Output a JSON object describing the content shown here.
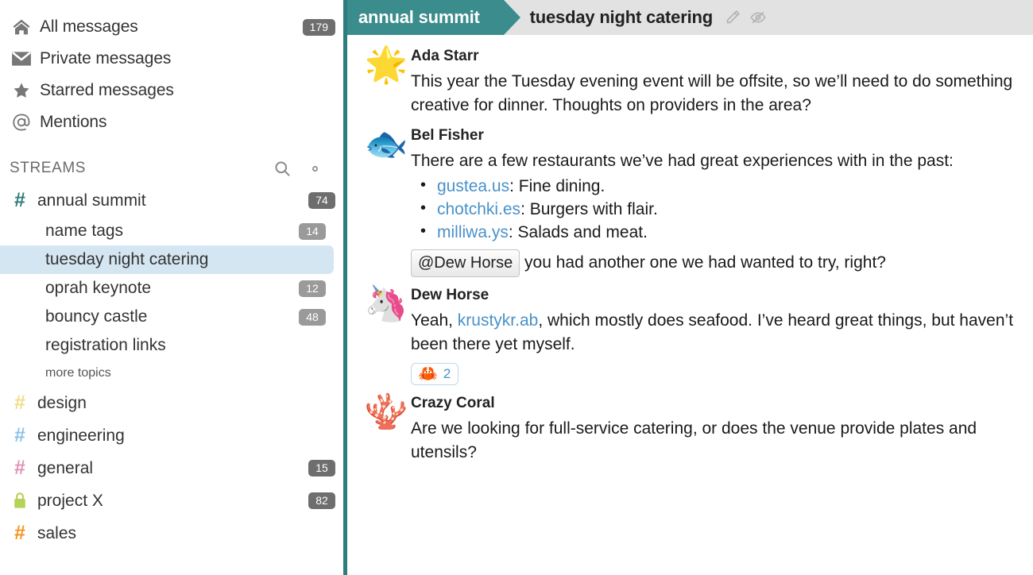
{
  "sidebar": {
    "nav": [
      {
        "icon": "home-icon",
        "label": "All messages",
        "badge": "179",
        "name": "sidebar-item-all-messages"
      },
      {
        "icon": "envelope-icon",
        "label": "Private messages",
        "badge": "",
        "name": "sidebar-item-private-messages"
      },
      {
        "icon": "star-icon",
        "label": "Starred messages",
        "badge": "",
        "name": "sidebar-item-starred-messages"
      },
      {
        "icon": "at-icon",
        "label": "Mentions",
        "badge": "",
        "name": "sidebar-item-mentions"
      }
    ],
    "streams_header": {
      "title": "STREAMS",
      "search_icon": "search-icon",
      "gear_icon": "gear-icon"
    },
    "streams": [
      {
        "name": "annual summit",
        "badge": "74",
        "color": "#2e7a7a",
        "private": false
      },
      {
        "name": "design",
        "badge": "",
        "color": "#f2dd8a",
        "private": false
      },
      {
        "name": "engineering",
        "badge": "",
        "color": "#8cc3e8",
        "private": false
      },
      {
        "name": "general",
        "badge": "15",
        "color": "#df94b4",
        "private": false
      },
      {
        "name": "project X",
        "badge": "82",
        "color": "#b5d359",
        "private": true
      },
      {
        "name": "sales",
        "badge": "",
        "color": "#f39422",
        "private": false
      }
    ],
    "topics": [
      {
        "name": "name tags",
        "badge": "14",
        "active": false
      },
      {
        "name": "tuesday night catering",
        "badge": "",
        "active": true
      },
      {
        "name": "oprah keynote",
        "badge": "12",
        "active": false
      },
      {
        "name": "bouncy castle",
        "badge": "48",
        "active": false
      },
      {
        "name": "registration links",
        "badge": "",
        "active": false
      }
    ],
    "more_topics_label": "more topics"
  },
  "topbar": {
    "stream_label": "annual summit",
    "topic_label": "tuesday night catering",
    "edit_icon": "pencil-icon",
    "mute_icon": "eye-off-icon",
    "stream_color": "#3b8c8c",
    "background": "#e2e2e2"
  },
  "messages": [
    {
      "sender": "Ada Starr",
      "avatar_emoji": "🌟",
      "avatar_name": "starfish-avatar",
      "body": "This year the Tuesday evening event will be offsite, so we’ll need to do something creative for dinner. Thoughts on providers in the area?"
    },
    {
      "sender": "Bel Fisher",
      "avatar_emoji": "🐟",
      "avatar_name": "tropical-fish-avatar",
      "intro": "There are a few restaurants we’ve had great experiences with in the past:",
      "bullets": [
        {
          "link": "gustea.us",
          "rest": ": Fine dining."
        },
        {
          "link": "chotchki.es",
          "rest": ": Burgers with flair."
        },
        {
          "link": "milliwa.ys",
          "rest": ": Salads and meat."
        }
      ],
      "mention": "@Dew Horse",
      "mention_rest": " you had another one we had wanted to try, right?"
    },
    {
      "sender": "Dew Horse",
      "avatar_emoji": "🦄",
      "avatar_name": "seahorse-avatar",
      "pre_link": "Yeah, ",
      "link": "krustykr.ab",
      "post_link": ", which mostly does seafood. I’ve heard great things, but haven’t been there yet myself.",
      "reaction": {
        "emoji": "🦀",
        "emoji_name": "crab-emoji",
        "count": "2"
      }
    },
    {
      "sender": "Crazy Coral",
      "avatar_emoji": "🪸",
      "avatar_name": "coral-avatar",
      "body": "Are we looking for full-service catering, or does the venue provide plates and utensils?"
    }
  ]
}
